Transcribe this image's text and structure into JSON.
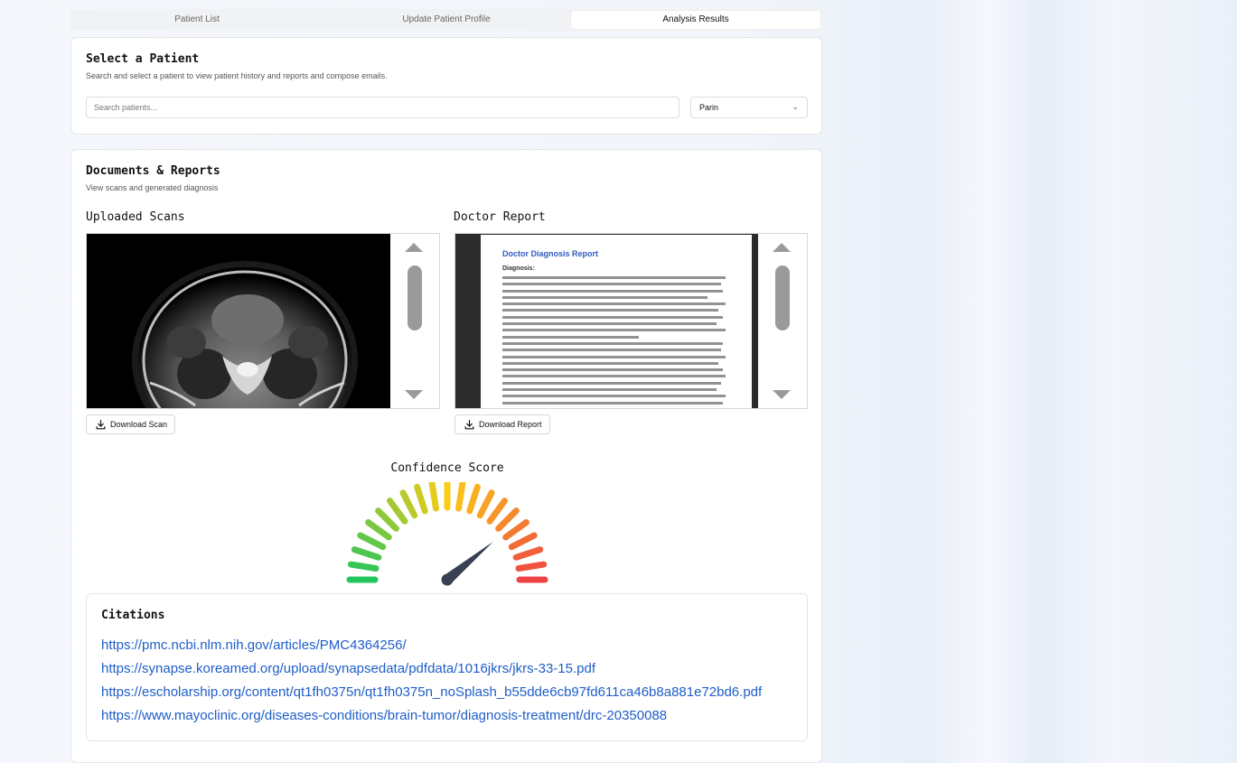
{
  "tabs": [
    "Patient List",
    "Update Patient Profile",
    "Analysis Results"
  ],
  "active_tab": "Analysis Results",
  "select_patient": {
    "title": "Select a Patient",
    "subtitle": "Search and select a patient to view patient history and reports and compose emails.",
    "search_placeholder": "Search patients...",
    "selected_patient": "Parin"
  },
  "documents": {
    "title": "Documents & Reports",
    "subtitle": "View scans and generated diagnosis",
    "scans_heading": "Uploaded Scans",
    "report_heading": "Doctor Report",
    "download_scan_label": "Download Scan",
    "download_report_label": "Download Report",
    "report_preview": {
      "title": "Doctor Diagnosis Report",
      "section": "Diagnosis:"
    }
  },
  "confidence": {
    "title": "Confidence Score",
    "value_fraction": 0.78,
    "colors": {
      "low": "#22c55e",
      "mid": "#facc15",
      "high": "#ef4444",
      "needle": "#374151"
    }
  },
  "citations": {
    "title": "Citations",
    "links": [
      "https://pmc.ncbi.nlm.nih.gov/articles/PMC4364256/",
      "https://synapse.koreamed.org/upload/synapsedata/pdfdata/1016jkrs/jkrs-33-15.pdf",
      "https://escholarship.org/content/qt1fh0375n/qt1fh0375n_noSplash_b55dde6cb97fd611ca46b8a881e72bd6.pdf",
      "https://www.mayoclinic.org/diseases-conditions/brain-tumor/diagnosis-treatment/drc-20350088"
    ]
  },
  "icons": [
    "download-icon",
    "chevron-down-icon",
    "scroll-up-icon",
    "scroll-down-icon"
  ]
}
